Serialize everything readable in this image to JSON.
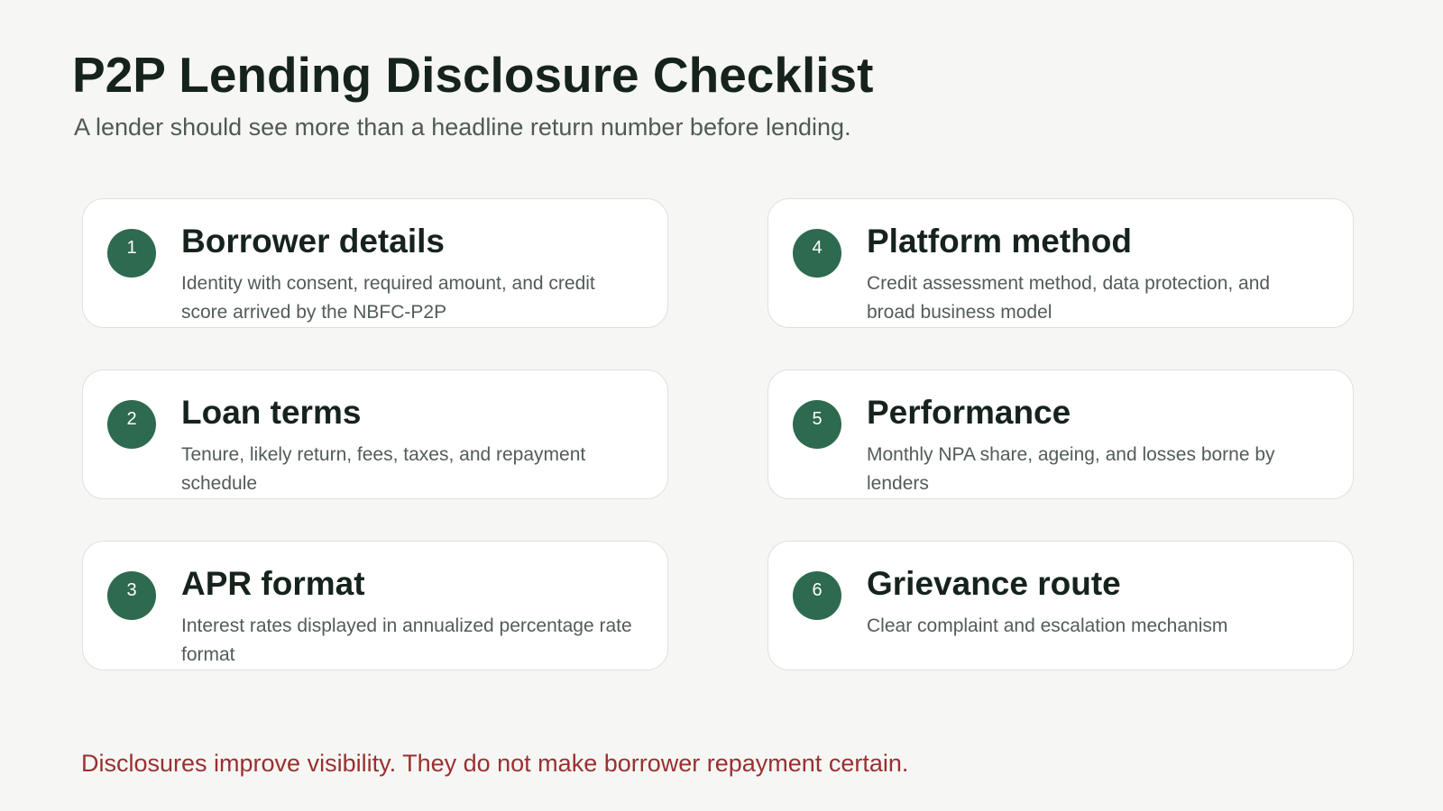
{
  "page": {
    "title": "P2P Lending Disclosure Checklist",
    "subtitle": "A lender should see more than a headline return number before lending.",
    "footer_note": "Disclosures improve visibility. They do not make borrower repayment certain."
  },
  "colors": {
    "background": "#f6f7f5",
    "badge": "#2d6a4f",
    "title_text": "#16231c",
    "body_text": "#525c57",
    "warning_text": "#9b2f2f",
    "card_background": "#ffffff",
    "card_border": "#dde1de"
  },
  "items": [
    {
      "number": "1",
      "title": "Borrower details",
      "description": "Identity with consent, required amount, and credit score arrived by the NBFC-P2P"
    },
    {
      "number": "4",
      "title": "Platform method",
      "description": "Credit assessment method, data protection, and broad business model"
    },
    {
      "number": "2",
      "title": "Loan terms",
      "description": "Tenure, likely return, fees, taxes, and repayment schedule"
    },
    {
      "number": "5",
      "title": "Performance",
      "description": "Monthly NPA share, ageing, and losses borne by lenders"
    },
    {
      "number": "3",
      "title": "APR format",
      "description": "Interest rates displayed in annualized percentage rate format"
    },
    {
      "number": "6",
      "title": "Grievance route",
      "description": "Clear complaint and escalation mechanism"
    }
  ]
}
